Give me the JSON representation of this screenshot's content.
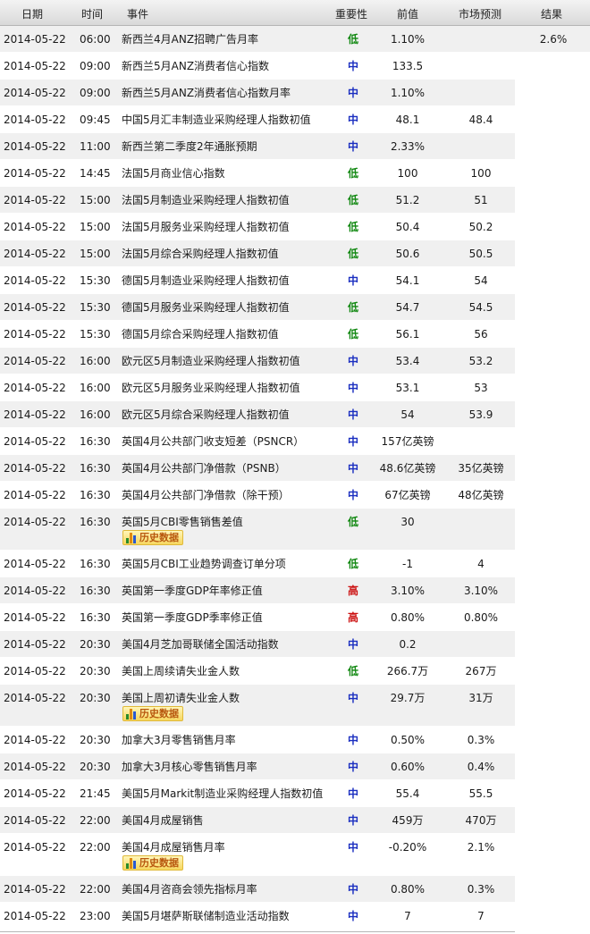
{
  "header": {
    "date": "日期",
    "time": "时间",
    "event": "事件",
    "importance": "重要性",
    "previous": "前值",
    "forecast": "市场预测",
    "result": "结果"
  },
  "history_label": "历史数据",
  "rows": [
    {
      "date": "2014-05-22",
      "time": "06:00",
      "event": "新西兰4月ANZ招聘广告月率",
      "importance": "低",
      "level": "low",
      "previous": "1.10%",
      "forecast": "",
      "result": "2.6%"
    },
    {
      "date": "2014-05-22",
      "time": "09:00",
      "event": "新西兰5月ANZ消费者信心指数",
      "importance": "中",
      "level": "mid",
      "previous": "133.5",
      "forecast": "",
      "result": ""
    },
    {
      "date": "2014-05-22",
      "time": "09:00",
      "event": "新西兰5月ANZ消费者信心指数月率",
      "importance": "中",
      "level": "mid",
      "previous": "1.10%",
      "forecast": "",
      "result": ""
    },
    {
      "date": "2014-05-22",
      "time": "09:45",
      "event": "中国5月汇丰制造业采购经理人指数初值",
      "importance": "中",
      "level": "mid",
      "previous": "48.1",
      "forecast": "48.4",
      "result": ""
    },
    {
      "date": "2014-05-22",
      "time": "11:00",
      "event": "新西兰第二季度2年通胀预期",
      "importance": "中",
      "level": "mid",
      "previous": "2.33%",
      "forecast": "",
      "result": ""
    },
    {
      "date": "2014-05-22",
      "time": "14:45",
      "event": "法国5月商业信心指数",
      "importance": "低",
      "level": "low",
      "previous": "100",
      "forecast": "100",
      "result": ""
    },
    {
      "date": "2014-05-22",
      "time": "15:00",
      "event": "法国5月制造业采购经理人指数初值",
      "importance": "低",
      "level": "low",
      "previous": "51.2",
      "forecast": "51",
      "result": ""
    },
    {
      "date": "2014-05-22",
      "time": "15:00",
      "event": "法国5月服务业采购经理人指数初值",
      "importance": "低",
      "level": "low",
      "previous": "50.4",
      "forecast": "50.2",
      "result": ""
    },
    {
      "date": "2014-05-22",
      "time": "15:00",
      "event": "法国5月综合采购经理人指数初值",
      "importance": "低",
      "level": "low",
      "previous": "50.6",
      "forecast": "50.5",
      "result": ""
    },
    {
      "date": "2014-05-22",
      "time": "15:30",
      "event": "德国5月制造业采购经理人指数初值",
      "importance": "中",
      "level": "mid",
      "previous": "54.1",
      "forecast": "54",
      "result": ""
    },
    {
      "date": "2014-05-22",
      "time": "15:30",
      "event": "德国5月服务业采购经理人指数初值",
      "importance": "低",
      "level": "low",
      "previous": "54.7",
      "forecast": "54.5",
      "result": ""
    },
    {
      "date": "2014-05-22",
      "time": "15:30",
      "event": "德国5月综合采购经理人指数初值",
      "importance": "低",
      "level": "low",
      "previous": "56.1",
      "forecast": "56",
      "result": ""
    },
    {
      "date": "2014-05-22",
      "time": "16:00",
      "event": "欧元区5月制造业采购经理人指数初值",
      "importance": "中",
      "level": "mid",
      "previous": "53.4",
      "forecast": "53.2",
      "result": ""
    },
    {
      "date": "2014-05-22",
      "time": "16:00",
      "event": "欧元区5月服务业采购经理人指数初值",
      "importance": "中",
      "level": "mid",
      "previous": "53.1",
      "forecast": "53",
      "result": ""
    },
    {
      "date": "2014-05-22",
      "time": "16:00",
      "event": "欧元区5月综合采购经理人指数初值",
      "importance": "中",
      "level": "mid",
      "previous": "54",
      "forecast": "53.9",
      "result": ""
    },
    {
      "date": "2014-05-22",
      "time": "16:30",
      "event": "英国4月公共部门收支短差（PSNCR）",
      "importance": "中",
      "level": "mid",
      "previous": "157亿英镑",
      "forecast": "",
      "result": ""
    },
    {
      "date": "2014-05-22",
      "time": "16:30",
      "event": "英国4月公共部门净借款（PSNB）",
      "importance": "中",
      "level": "mid",
      "previous": "48.6亿英镑",
      "forecast": "35亿英镑",
      "result": ""
    },
    {
      "date": "2014-05-22",
      "time": "16:30",
      "event": "英国4月公共部门净借款（除干预）",
      "importance": "中",
      "level": "mid",
      "previous": "67亿英镑",
      "forecast": "48亿英镑",
      "result": ""
    },
    {
      "date": "2014-05-22",
      "time": "16:30",
      "event": "英国5月CBI零售销售差值",
      "importance": "低",
      "level": "low",
      "previous": "30",
      "forecast": "",
      "result": "",
      "history": true
    },
    {
      "date": "2014-05-22",
      "time": "16:30",
      "event": "英国5月CBI工业趋势调查订单分项",
      "importance": "低",
      "level": "low",
      "previous": "-1",
      "forecast": "4",
      "result": ""
    },
    {
      "date": "2014-05-22",
      "time": "16:30",
      "event": "英国第一季度GDP年率修正值",
      "importance": "高",
      "level": "high",
      "previous": "3.10%",
      "forecast": "3.10%",
      "result": ""
    },
    {
      "date": "2014-05-22",
      "time": "16:30",
      "event": "英国第一季度GDP季率修正值",
      "importance": "高",
      "level": "high",
      "previous": "0.80%",
      "forecast": "0.80%",
      "result": ""
    },
    {
      "date": "2014-05-22",
      "time": "20:30",
      "event": "美国4月芝加哥联储全国活动指数",
      "importance": "中",
      "level": "mid",
      "previous": "0.2",
      "forecast": "",
      "result": ""
    },
    {
      "date": "2014-05-22",
      "time": "20:30",
      "event": "美国上周续请失业金人数",
      "importance": "低",
      "level": "low",
      "previous": "266.7万",
      "forecast": "267万",
      "result": ""
    },
    {
      "date": "2014-05-22",
      "time": "20:30",
      "event": "美国上周初请失业金人数",
      "importance": "中",
      "level": "mid",
      "previous": "29.7万",
      "forecast": "31万",
      "result": "",
      "history": true
    },
    {
      "date": "2014-05-22",
      "time": "20:30",
      "event": "加拿大3月零售销售月率",
      "importance": "中",
      "level": "mid",
      "previous": "0.50%",
      "forecast": "0.3%",
      "result": ""
    },
    {
      "date": "2014-05-22",
      "time": "20:30",
      "event": "加拿大3月核心零售销售月率",
      "importance": "中",
      "level": "mid",
      "previous": "0.60%",
      "forecast": "0.4%",
      "result": ""
    },
    {
      "date": "2014-05-22",
      "time": "21:45",
      "event": "美国5月Markit制造业采购经理人指数初值",
      "importance": "中",
      "level": "mid",
      "previous": "55.4",
      "forecast": "55.5",
      "result": ""
    },
    {
      "date": "2014-05-22",
      "time": "22:00",
      "event": "美国4月成屋销售",
      "importance": "中",
      "level": "mid",
      "previous": "459万",
      "forecast": "470万",
      "result": ""
    },
    {
      "date": "2014-05-22",
      "time": "22:00",
      "event": "美国4月成屋销售月率",
      "importance": "中",
      "level": "mid",
      "previous": "-0.20%",
      "forecast": "2.1%",
      "result": "",
      "history": true
    },
    {
      "date": "2014-05-22",
      "time": "22:00",
      "event": "美国4月咨商会领先指标月率",
      "importance": "中",
      "level": "mid",
      "previous": "0.80%",
      "forecast": "0.3%",
      "result": ""
    },
    {
      "date": "2014-05-22",
      "time": "23:00",
      "event": "美国5月堪萨斯联储制造业活动指数",
      "importance": "中",
      "level": "mid",
      "previous": "7",
      "forecast": "7",
      "result": ""
    }
  ]
}
